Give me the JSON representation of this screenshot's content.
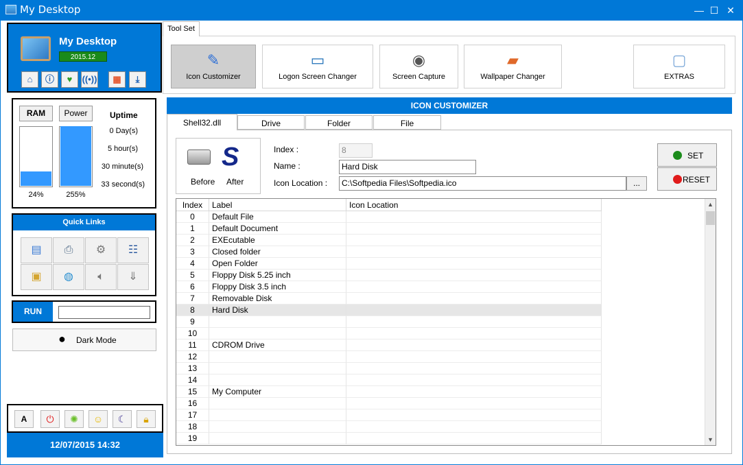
{
  "window": {
    "title": "My Desktop",
    "minimize": "—",
    "maximize": "☐",
    "close": "✕"
  },
  "brand": {
    "title": "My Desktop",
    "version": "2015.12"
  },
  "brand_buttons": [
    "home-icon",
    "info-icon",
    "heart-plus-icon",
    "broadcast-icon",
    "apps-icon",
    "download-icon"
  ],
  "stats": {
    "ram_label": "RAM",
    "power_label": "Power",
    "uptime_label": "Uptime",
    "ram_level": 0.24,
    "power_level": 1.0,
    "ram_pct": "24%",
    "power_pct": "255%",
    "days": "0 Day(s)",
    "hours": "5 hour(s)",
    "minutes": "30 minute(s)",
    "seconds": "33 second(s)"
  },
  "quick_links": {
    "title": "Quick Links",
    "icons": [
      "network-settings-icon",
      "printer-icon",
      "gears-icon",
      "task-list-icon",
      "folder-options-icon",
      "internet-icon",
      "speaker-icon",
      "usb-icon"
    ]
  },
  "run": {
    "label": "RUN",
    "value": ""
  },
  "dark_mode": {
    "label": "Dark Mode"
  },
  "bottom_tools": {
    "font_label": "A",
    "icons": [
      "power-icon",
      "lime-icon",
      "smiley-icon",
      "moon-icon",
      "lock-icon"
    ]
  },
  "clock": {
    "text": "12/07/2015  14:32"
  },
  "toolset_tab": "Tool Set",
  "tools": [
    {
      "label": "Icon Customizer",
      "icon": "brush-icon"
    },
    {
      "label": "Logon Screen Changer",
      "icon": "monitor-icon"
    },
    {
      "label": "Screen Capture",
      "icon": "camera-icon"
    },
    {
      "label": "Wallpaper Changer",
      "icon": "wallpaper-icon"
    },
    {
      "label": "EXTRAS",
      "icon": "window-icon"
    }
  ],
  "section_title": "ICON CUSTOMIZER",
  "sub_tabs": [
    "Shell32.dll",
    "Drive",
    "Folder",
    "File"
  ],
  "preview": {
    "before": "Before",
    "after": "After"
  },
  "form": {
    "index_label": "Index :",
    "index_value": "8",
    "name_label": "Name :",
    "name_value": "Hard Disk",
    "location_label": "Icon Location :",
    "location_value": "C:\\Softpedia Files\\Softpedia.ico",
    "browse_label": "..."
  },
  "buttons": {
    "set": "SET",
    "reset": "RESET",
    "set_color": "#1c8c1c",
    "reset_color": "#e01b1b"
  },
  "table": {
    "columns": [
      "Index",
      "Label",
      "Icon Location"
    ],
    "rows": [
      {
        "index": "0",
        "label": "Default File"
      },
      {
        "index": "1",
        "label": "Default Document"
      },
      {
        "index": "2",
        "label": "EXEcutable"
      },
      {
        "index": "3",
        "label": "Closed folder"
      },
      {
        "index": "4",
        "label": "Open Folder"
      },
      {
        "index": "5",
        "label": "Floppy Disk 5.25 inch"
      },
      {
        "index": "6",
        "label": "Floppy Disk 3.5 inch"
      },
      {
        "index": "7",
        "label": "Removable Disk"
      },
      {
        "index": "8",
        "label": "Hard Disk"
      },
      {
        "index": "9",
        "label": ""
      },
      {
        "index": "10",
        "label": ""
      },
      {
        "index": "11",
        "label": "CDROM Drive"
      },
      {
        "index": "12",
        "label": ""
      },
      {
        "index": "13",
        "label": ""
      },
      {
        "index": "14",
        "label": ""
      },
      {
        "index": "15",
        "label": "My Computer"
      },
      {
        "index": "16",
        "label": ""
      },
      {
        "index": "17",
        "label": ""
      },
      {
        "index": "18",
        "label": ""
      },
      {
        "index": "19",
        "label": ""
      }
    ],
    "selected_index": "8"
  }
}
